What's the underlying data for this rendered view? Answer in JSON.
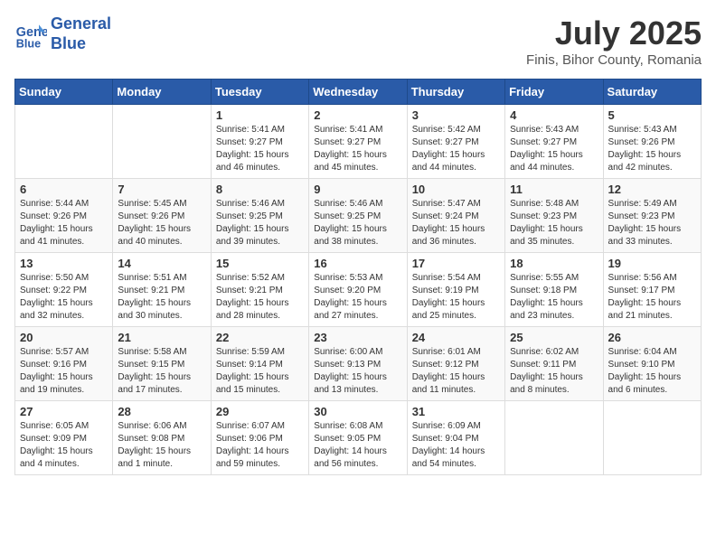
{
  "header": {
    "logo_line1": "General",
    "logo_line2": "Blue",
    "month_title": "July 2025",
    "location": "Finis, Bihor County, Romania"
  },
  "days_of_week": [
    "Sunday",
    "Monday",
    "Tuesday",
    "Wednesday",
    "Thursday",
    "Friday",
    "Saturday"
  ],
  "weeks": [
    [
      {
        "day": "",
        "info": ""
      },
      {
        "day": "",
        "info": ""
      },
      {
        "day": "1",
        "info": "Sunrise: 5:41 AM\nSunset: 9:27 PM\nDaylight: 15 hours and 46 minutes."
      },
      {
        "day": "2",
        "info": "Sunrise: 5:41 AM\nSunset: 9:27 PM\nDaylight: 15 hours and 45 minutes."
      },
      {
        "day": "3",
        "info": "Sunrise: 5:42 AM\nSunset: 9:27 PM\nDaylight: 15 hours and 44 minutes."
      },
      {
        "day": "4",
        "info": "Sunrise: 5:43 AM\nSunset: 9:27 PM\nDaylight: 15 hours and 44 minutes."
      },
      {
        "day": "5",
        "info": "Sunrise: 5:43 AM\nSunset: 9:26 PM\nDaylight: 15 hours and 42 minutes."
      }
    ],
    [
      {
        "day": "6",
        "info": "Sunrise: 5:44 AM\nSunset: 9:26 PM\nDaylight: 15 hours and 41 minutes."
      },
      {
        "day": "7",
        "info": "Sunrise: 5:45 AM\nSunset: 9:26 PM\nDaylight: 15 hours and 40 minutes."
      },
      {
        "day": "8",
        "info": "Sunrise: 5:46 AM\nSunset: 9:25 PM\nDaylight: 15 hours and 39 minutes."
      },
      {
        "day": "9",
        "info": "Sunrise: 5:46 AM\nSunset: 9:25 PM\nDaylight: 15 hours and 38 minutes."
      },
      {
        "day": "10",
        "info": "Sunrise: 5:47 AM\nSunset: 9:24 PM\nDaylight: 15 hours and 36 minutes."
      },
      {
        "day": "11",
        "info": "Sunrise: 5:48 AM\nSunset: 9:23 PM\nDaylight: 15 hours and 35 minutes."
      },
      {
        "day": "12",
        "info": "Sunrise: 5:49 AM\nSunset: 9:23 PM\nDaylight: 15 hours and 33 minutes."
      }
    ],
    [
      {
        "day": "13",
        "info": "Sunrise: 5:50 AM\nSunset: 9:22 PM\nDaylight: 15 hours and 32 minutes."
      },
      {
        "day": "14",
        "info": "Sunrise: 5:51 AM\nSunset: 9:21 PM\nDaylight: 15 hours and 30 minutes."
      },
      {
        "day": "15",
        "info": "Sunrise: 5:52 AM\nSunset: 9:21 PM\nDaylight: 15 hours and 28 minutes."
      },
      {
        "day": "16",
        "info": "Sunrise: 5:53 AM\nSunset: 9:20 PM\nDaylight: 15 hours and 27 minutes."
      },
      {
        "day": "17",
        "info": "Sunrise: 5:54 AM\nSunset: 9:19 PM\nDaylight: 15 hours and 25 minutes."
      },
      {
        "day": "18",
        "info": "Sunrise: 5:55 AM\nSunset: 9:18 PM\nDaylight: 15 hours and 23 minutes."
      },
      {
        "day": "19",
        "info": "Sunrise: 5:56 AM\nSunset: 9:17 PM\nDaylight: 15 hours and 21 minutes."
      }
    ],
    [
      {
        "day": "20",
        "info": "Sunrise: 5:57 AM\nSunset: 9:16 PM\nDaylight: 15 hours and 19 minutes."
      },
      {
        "day": "21",
        "info": "Sunrise: 5:58 AM\nSunset: 9:15 PM\nDaylight: 15 hours and 17 minutes."
      },
      {
        "day": "22",
        "info": "Sunrise: 5:59 AM\nSunset: 9:14 PM\nDaylight: 15 hours and 15 minutes."
      },
      {
        "day": "23",
        "info": "Sunrise: 6:00 AM\nSunset: 9:13 PM\nDaylight: 15 hours and 13 minutes."
      },
      {
        "day": "24",
        "info": "Sunrise: 6:01 AM\nSunset: 9:12 PM\nDaylight: 15 hours and 11 minutes."
      },
      {
        "day": "25",
        "info": "Sunrise: 6:02 AM\nSunset: 9:11 PM\nDaylight: 15 hours and 8 minutes."
      },
      {
        "day": "26",
        "info": "Sunrise: 6:04 AM\nSunset: 9:10 PM\nDaylight: 15 hours and 6 minutes."
      }
    ],
    [
      {
        "day": "27",
        "info": "Sunrise: 6:05 AM\nSunset: 9:09 PM\nDaylight: 15 hours and 4 minutes."
      },
      {
        "day": "28",
        "info": "Sunrise: 6:06 AM\nSunset: 9:08 PM\nDaylight: 15 hours and 1 minute."
      },
      {
        "day": "29",
        "info": "Sunrise: 6:07 AM\nSunset: 9:06 PM\nDaylight: 14 hours and 59 minutes."
      },
      {
        "day": "30",
        "info": "Sunrise: 6:08 AM\nSunset: 9:05 PM\nDaylight: 14 hours and 56 minutes."
      },
      {
        "day": "31",
        "info": "Sunrise: 6:09 AM\nSunset: 9:04 PM\nDaylight: 14 hours and 54 minutes."
      },
      {
        "day": "",
        "info": ""
      },
      {
        "day": "",
        "info": ""
      }
    ]
  ]
}
